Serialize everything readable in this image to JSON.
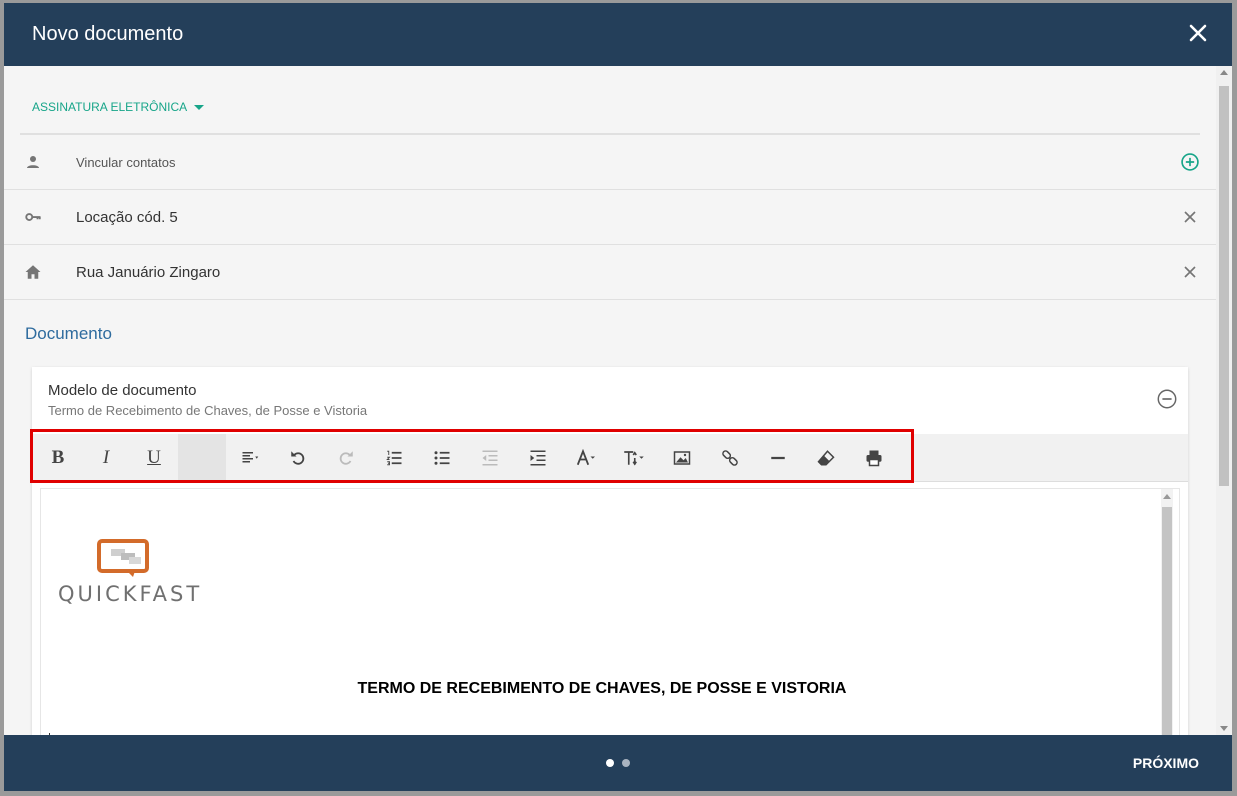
{
  "modal": {
    "title": "Novo documento"
  },
  "signature": {
    "type_label": "ASSINATURA ELETRÔNICA"
  },
  "rows": [
    {
      "icon": "person-icon",
      "text": "Vincular contatos",
      "action": "add-icon"
    },
    {
      "icon": "key-icon",
      "text": "Locação cód. 5",
      "action": "close-icon"
    },
    {
      "icon": "home-icon",
      "text": "Rua Januário Zingaro",
      "action": "close-icon"
    }
  ],
  "document": {
    "section_title": "Documento",
    "model_label": "Modelo de documento",
    "model_value": "Termo de Recebimento de Chaves, de Posse e Vistoria"
  },
  "toolbar": {
    "bold": "B",
    "italic": "I",
    "underline": "U",
    "buttons": [
      "bold",
      "italic",
      "underline",
      "style",
      "align",
      "undo",
      "redo",
      "ordered-list",
      "unordered-list",
      "outdent",
      "indent",
      "font-color",
      "font-size",
      "image",
      "link",
      "horizontal-rule",
      "clear-format",
      "print"
    ]
  },
  "editor": {
    "logo_text": "QUICKFAST",
    "doc_title": "TERMO DE RECEBIMENTO DE CHAVES, DE POSSE E VISTORIA"
  },
  "footer": {
    "next_label": "PRÓXIMO",
    "pages": 2,
    "current_page": 1
  },
  "colors": {
    "header": "#243f5a",
    "accent": "#17a589",
    "section": "#2e6b9e",
    "highlight": "#e00000"
  }
}
